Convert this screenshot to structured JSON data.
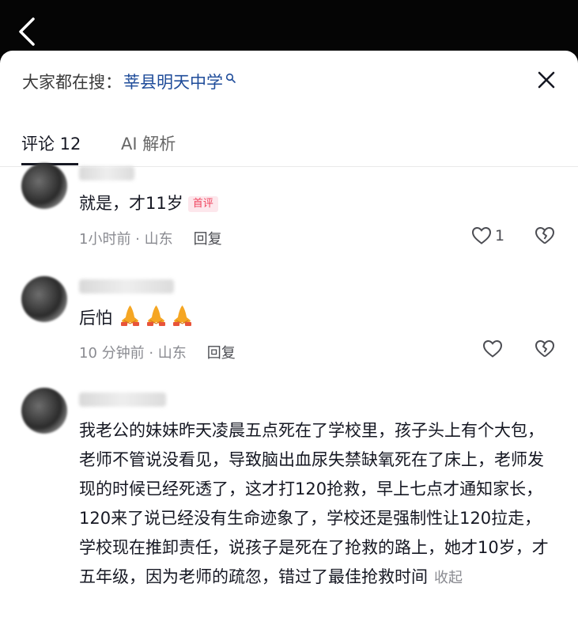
{
  "header": {
    "back_icon": "chevron-left-icon"
  },
  "search": {
    "prefix": "大家都在搜：",
    "term": "莘县明天中学",
    "icon": "search-icon"
  },
  "close_icon": "close-icon",
  "tabs": [
    {
      "label": "评论 12",
      "active": true
    },
    {
      "label": "AI 解析",
      "active": false
    }
  ],
  "comments": [
    {
      "text": "就是，才11岁",
      "badge": "首评",
      "time_location": "1小时前 · 山东",
      "reply_label": "回复",
      "like_count": "1"
    },
    {
      "text": "后怕",
      "emoji": "praying-hands-icon",
      "emoji_count": 3,
      "time_location": "10 分钟前 · 山东",
      "reply_label": "回复",
      "like_count": ""
    },
    {
      "text": "我老公的妹妹昨天凌晨五点死在了学校里，孩子头上有个大包，老师不管说没看见，导致脑出血尿失禁缺氧死在了床上，老师发现的时候已经死透了，这才打120抢救，早上七点才通知家长，120来了说已经没有生命迹象了，学校还是强制性让120拉走，学校现在推卸责任，说孩子是死在了抢救的路上，她才10岁，才五年级，因为老师的疏忽，错过了最佳抢救时间",
      "collapse_label": "收起"
    }
  ],
  "colors": {
    "accent_link": "#1f4c9a",
    "badge_text": "#f0455f",
    "badge_bg": "#fde7ec",
    "meta_gray": "#8a8b91"
  }
}
